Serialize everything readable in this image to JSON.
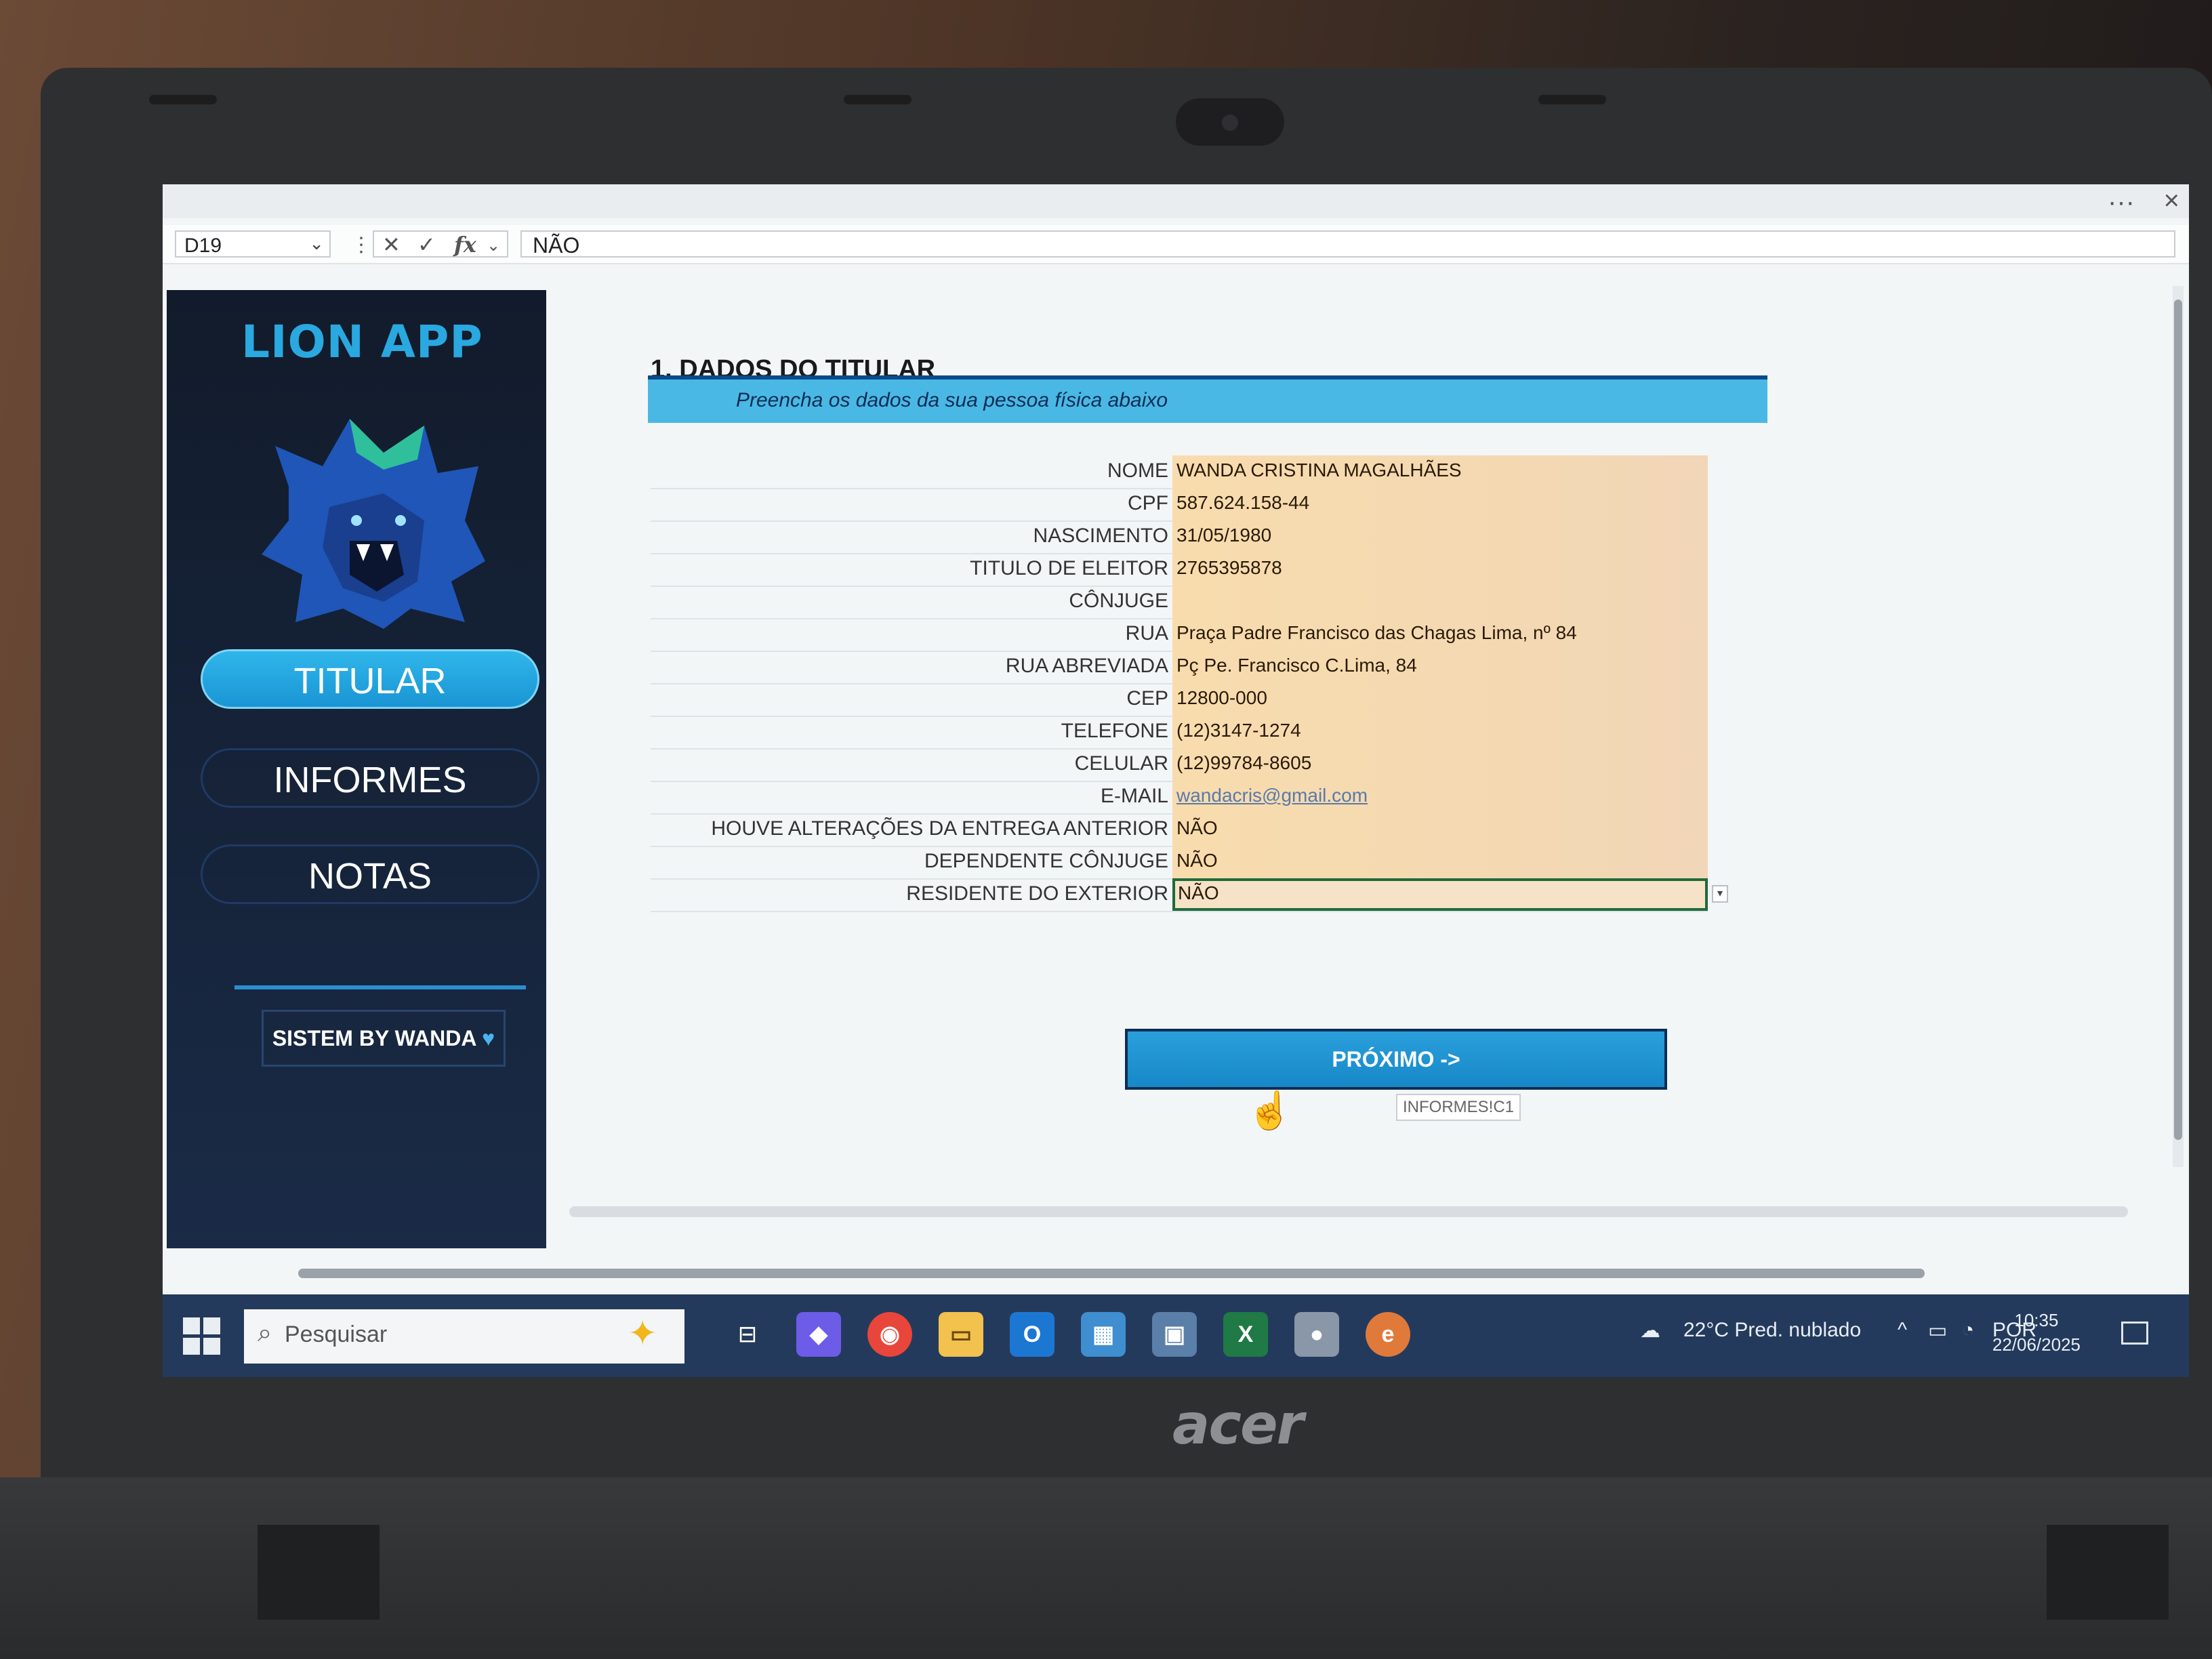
{
  "formula_bar": {
    "cell_ref": "D19",
    "value": "NÃO"
  },
  "sidebar": {
    "brand": "LION APP",
    "nav": [
      {
        "label": "TITULAR",
        "active": true
      },
      {
        "label": "INFORMES",
        "active": false
      },
      {
        "label": "NOTAS",
        "active": false
      }
    ],
    "signature": "SISTEM BY WANDA",
    "accent": "#2aa8e0"
  },
  "section": {
    "title": "1. DADOS DO TITULAR",
    "subtitle": "Preencha os dados da sua pessoa física abaixo"
  },
  "fields": [
    {
      "label": "NOME",
      "value": "WANDA CRISTINA MAGALHÃES"
    },
    {
      "label": "CPF",
      "value": "587.624.158-44"
    },
    {
      "label": "NASCIMENTO",
      "value": "31/05/1980"
    },
    {
      "label": "TITULO DE ELEITOR",
      "value": "2765395878"
    },
    {
      "label": "CÔNJUGE",
      "value": ""
    },
    {
      "label": "RUA",
      "value": "Praça Padre Francisco das Chagas Lima, nº 84"
    },
    {
      "label": "RUA ABREVIADA",
      "value": "Pç Pe. Francisco C.Lima, 84"
    },
    {
      "label": "CEP",
      "value": "12800-000"
    },
    {
      "label": "TELEFONE",
      "value": "(12)3147-1274"
    },
    {
      "label": "CELULAR",
      "value": "(12)99784-8605"
    },
    {
      "label": "E-MAIL",
      "value": "wandacris@gmail.com"
    },
    {
      "label": "HOUVE ALTERAÇÕES DA ENTREGA ANTERIOR",
      "value": "NÃO"
    },
    {
      "label": "DEPENDENTE CÔNJUGE",
      "value": "NÃO"
    },
    {
      "label": "RESIDENTE DO EXTERIOR",
      "value": "NÃO"
    }
  ],
  "next_button": {
    "label": "PRÓXIMO ->",
    "hint": "INFORMES!C1"
  },
  "taskbar": {
    "search_placeholder": "Pesquisar",
    "weather": "22°C  Pred. nublado",
    "language": "POR",
    "time": "10:35",
    "date": "22/06/2025"
  },
  "device": {
    "brand": "acer"
  }
}
